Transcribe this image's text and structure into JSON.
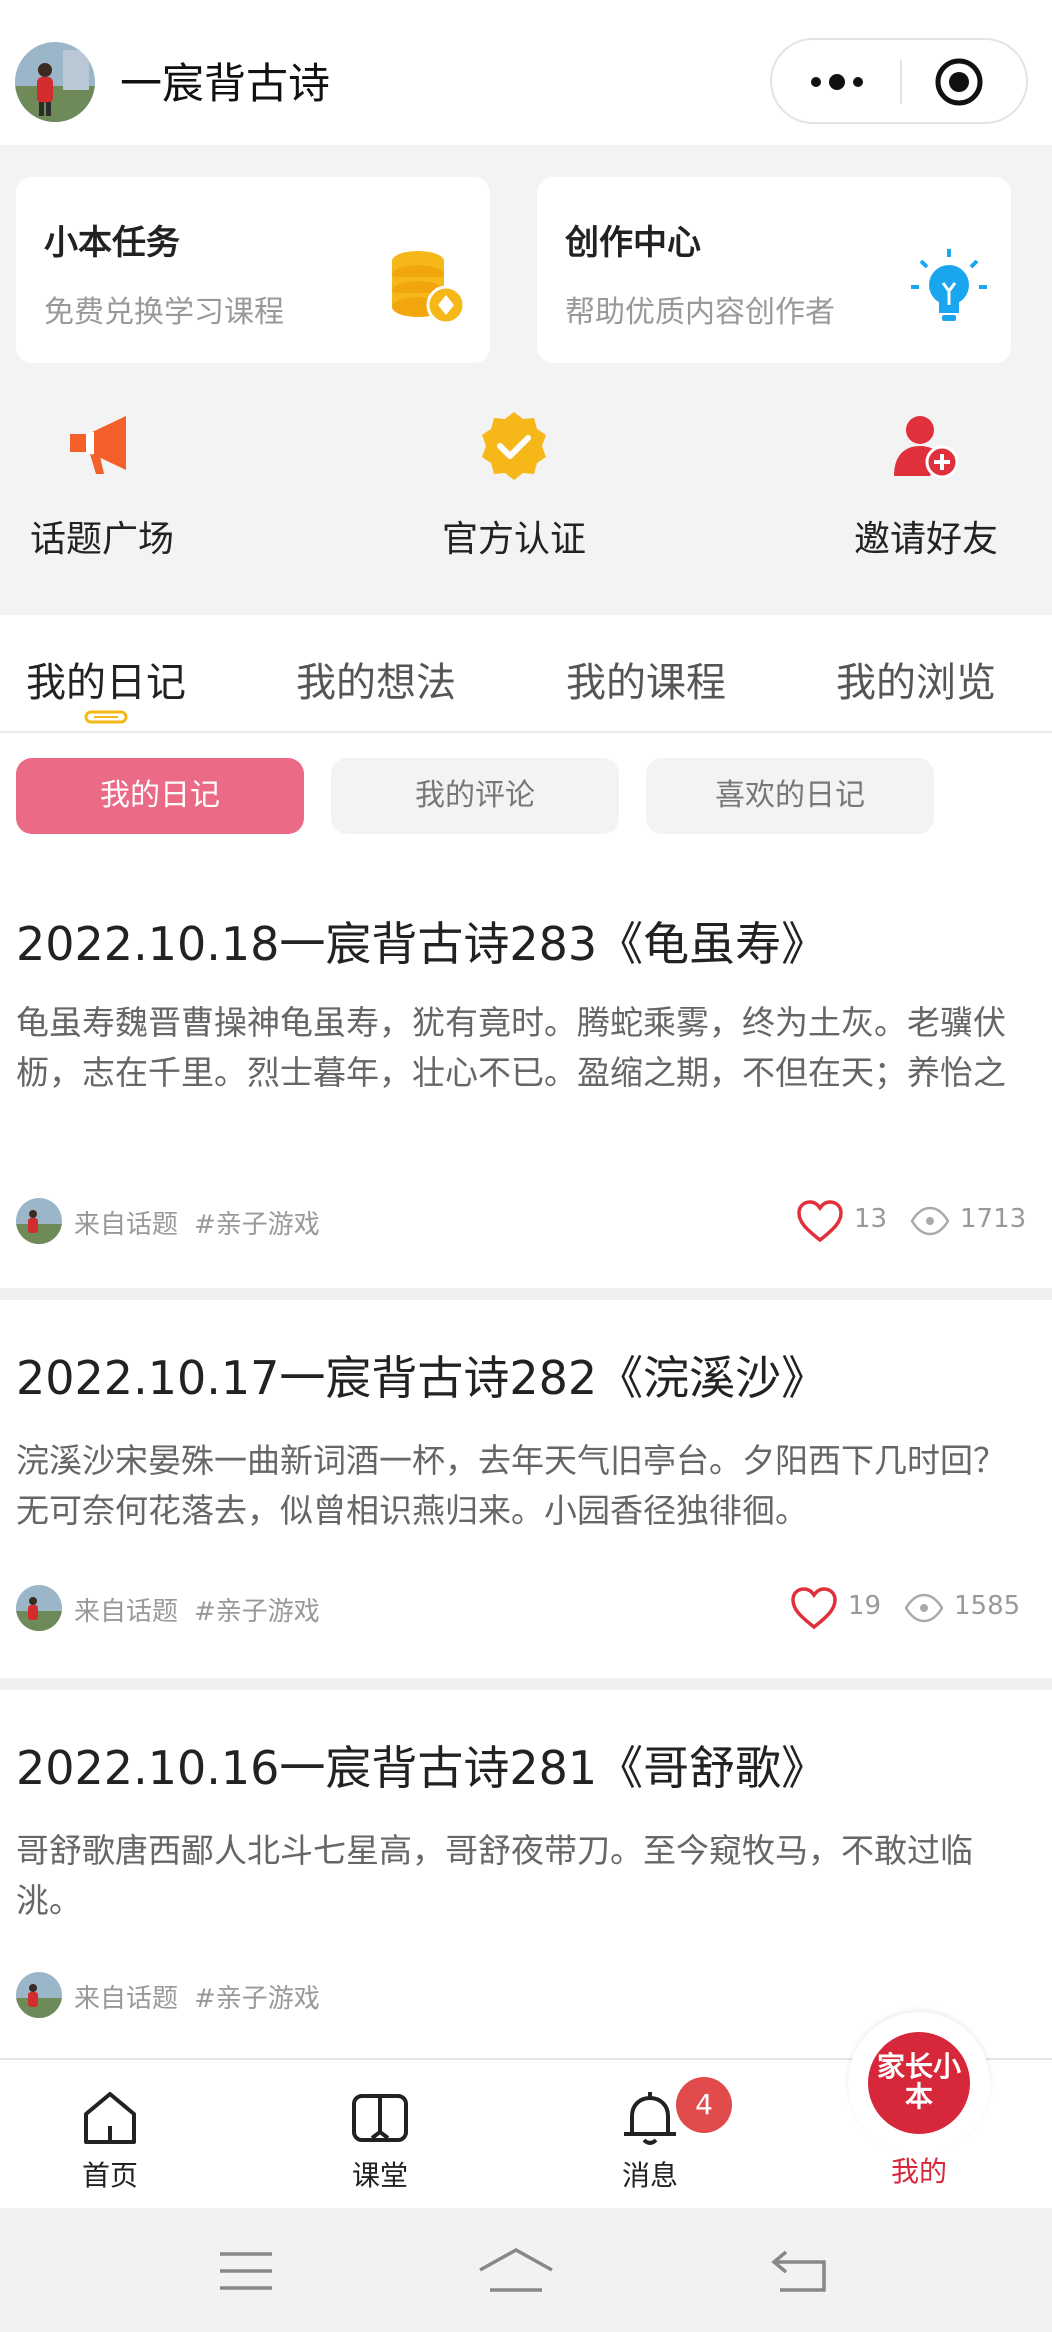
{
  "header": {
    "title": "一宸背古诗",
    "icons": {
      "avatar": "user-avatar",
      "more": "more-dots-icon",
      "close": "target-circle-icon"
    }
  },
  "cards": [
    {
      "title": "小本任务",
      "subtitle": "免费兑换学习课程",
      "icon": "coins-icon",
      "color": "#f6b719"
    },
    {
      "title": "创作中心",
      "subtitle": "帮助优质内容创作者",
      "icon": "lightbulb-icon",
      "color": "#1aa6ee"
    }
  ],
  "quick_actions": [
    {
      "label": "话题广场",
      "icon": "megaphone-icon",
      "color": "#f4602b"
    },
    {
      "label": "官方认证",
      "icon": "verified-badge-icon",
      "color": "#f6b719"
    },
    {
      "label": "邀请好友",
      "icon": "add-user-icon",
      "color": "#e0303b"
    }
  ],
  "tabs": [
    "我的日记",
    "我的想法",
    "我的课程",
    "我的浏览"
  ],
  "active_tab": 0,
  "sub_tabs": [
    "我的日记",
    "我的评论",
    "喜欢的日记"
  ],
  "active_sub_tab": 0,
  "posts": [
    {
      "title": "2022.10.18一宸背古诗283《龟虽寿》",
      "body": "龟虽寿魏晋曹操神龟虽寿，犹有竟时。腾蛇乘雾，终为土灰。老骥伏枥，志在千里。烈士暮年，壮心不已。盈缩之期，不但在天；养怡之",
      "source": "来自话题",
      "tag": "#亲子游戏",
      "likes": "13",
      "views": "1713"
    },
    {
      "title": "2022.10.17一宸背古诗282《浣溪沙》",
      "body": "浣溪沙宋晏殊一曲新词酒一杯，去年天气旧亭台。夕阳西下几时回？无可奈何花落去，似曾相识燕归来。小园香径独徘徊。",
      "source": "来自话题",
      "tag": "#亲子游戏",
      "likes": "19",
      "views": "1585"
    },
    {
      "title": "2022.10.16一宸背古诗281《哥舒歌》",
      "body": "哥舒歌唐西鄙人北斗七星高，哥舒夜带刀。至今窥牧马，不敢过临洮。",
      "source": "来自话题",
      "tag": "#亲子游戏"
    }
  ],
  "bottom_nav": [
    {
      "label": "首页",
      "icon": "home-icon"
    },
    {
      "label": "课堂",
      "icon": "book-icon"
    },
    {
      "label": "消息",
      "icon": "bell-icon",
      "badge": "4"
    },
    {
      "label": "我的",
      "icon": "brand-logo",
      "logo_text": "家长小本"
    }
  ],
  "colors": {
    "accent": "#eb6a85",
    "brand": "#d7283b",
    "badge": "#e14b4b"
  }
}
